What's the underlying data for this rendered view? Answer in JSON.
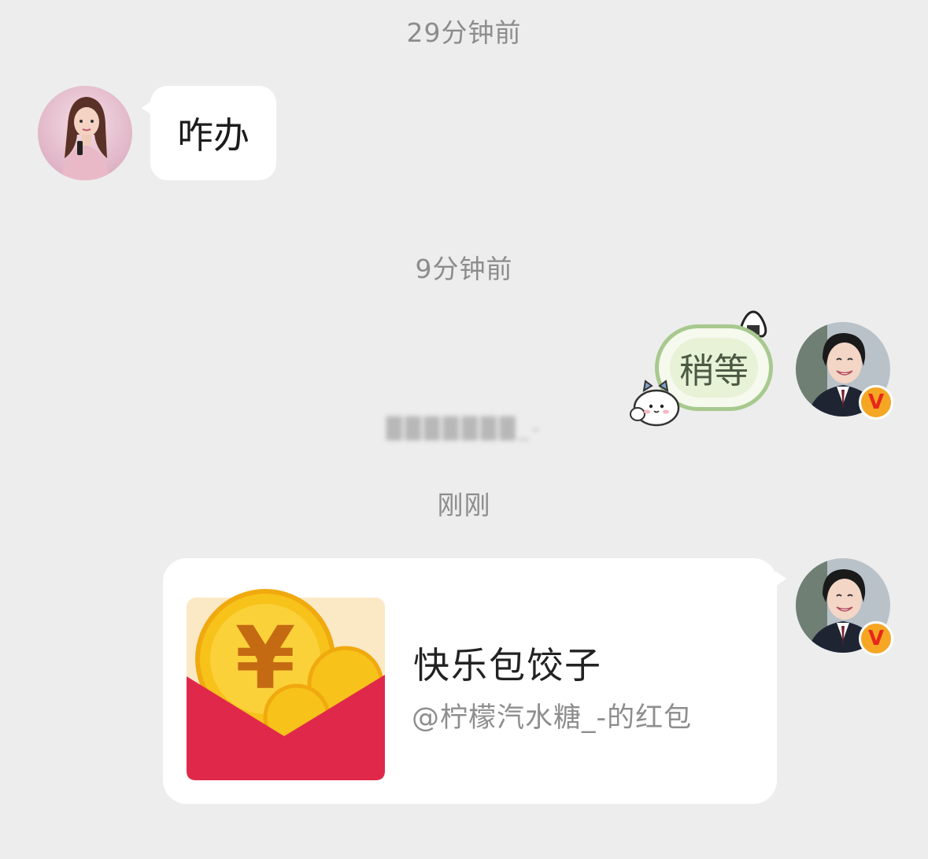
{
  "timestamps": {
    "first": "29分钟前",
    "second": "9分钟前",
    "third": "刚刚"
  },
  "messages": {
    "received_text": "咋办",
    "sent_sticker_text": "稍等",
    "blurred_caption": "███████_-"
  },
  "red_packet": {
    "title": "快乐包饺子",
    "subtitle": "@柠檬汽水糖_-的红包",
    "currency_symbol": "¥"
  },
  "badge": {
    "letter": "V",
    "color": "#f5a623"
  },
  "colors": {
    "background": "#ededed",
    "bubble": "#ffffff",
    "timestamp": "#8c8c8c",
    "envelope_red": "#e0294a",
    "coin_gold": "#f7c21a",
    "sticker_border": "#a8c98e"
  },
  "icons": {
    "avatar_left": "avatar-woman-pink-dress",
    "avatar_right": "avatar-student-uniform",
    "envelope": "red-envelope-icon",
    "sticker": "chiikawa-sticker"
  }
}
